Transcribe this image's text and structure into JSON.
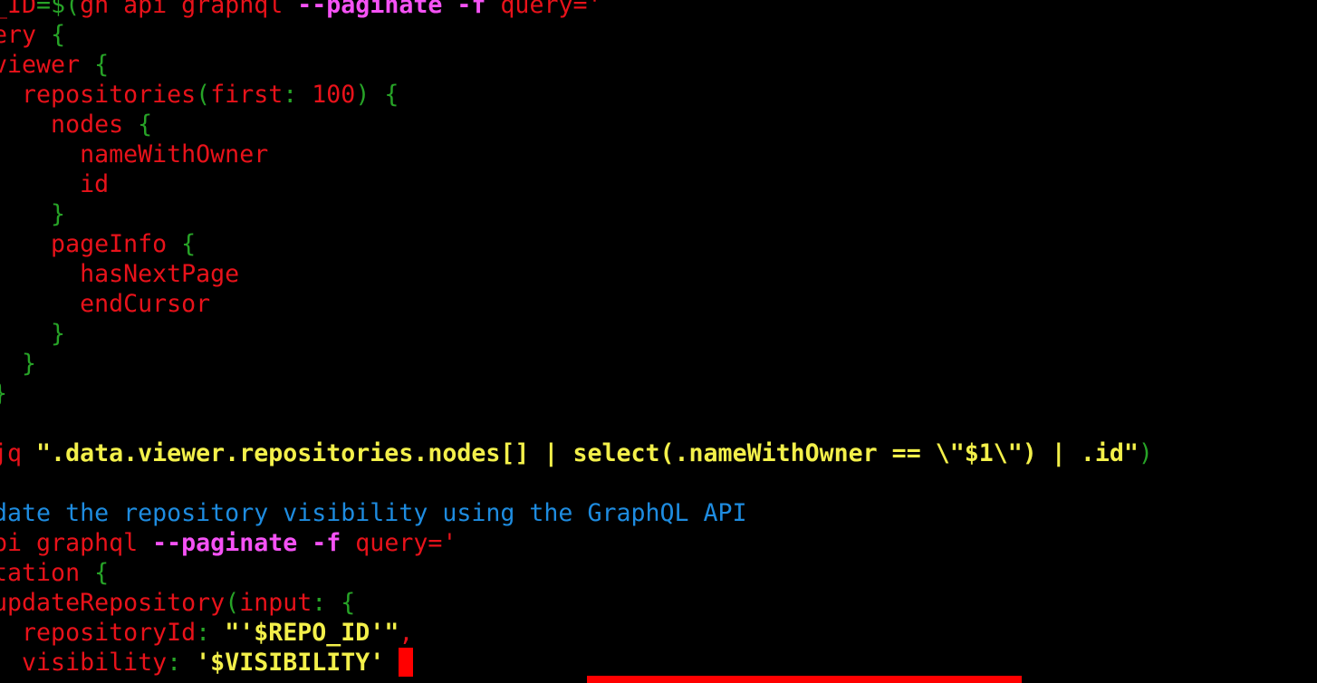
{
  "terminal": {
    "colors": {
      "background": "#000000",
      "red": "#e8121a",
      "green": "#27a327",
      "yellow": "#f3f04a",
      "magenta": "#f552f5",
      "blue": "#1e8ce0",
      "cursor": "#ff0000"
    },
    "lines": [
      {
        "tokens": [
          {
            "t": "D_ID",
            "c": "r"
          },
          {
            "t": "=",
            "c": "g"
          },
          {
            "t": "$(",
            "c": "g"
          },
          {
            "t": "gh api graphql ",
            "c": "r"
          },
          {
            "t": "--paginate -f",
            "c": "m"
          },
          {
            "t": " query",
            "c": "r"
          },
          {
            "t": "='",
            "c": "r"
          }
        ]
      },
      {
        "tokens": [
          {
            "t": "uery ",
            "c": "r"
          },
          {
            "t": "{",
            "c": "g"
          }
        ]
      },
      {
        "tokens": [
          {
            "t": " viewer ",
            "c": "r"
          },
          {
            "t": "{",
            "c": "g"
          }
        ]
      },
      {
        "tokens": [
          {
            "t": "   repositories",
            "c": "r"
          },
          {
            "t": "(",
            "c": "g"
          },
          {
            "t": "first",
            "c": "r"
          },
          {
            "t": ": ",
            "c": "g"
          },
          {
            "t": "100",
            "c": "r"
          },
          {
            "t": ") {",
            "c": "g"
          }
        ]
      },
      {
        "tokens": [
          {
            "t": "     nodes ",
            "c": "r"
          },
          {
            "t": "{",
            "c": "g"
          }
        ]
      },
      {
        "tokens": [
          {
            "t": "       nameWithOwner",
            "c": "r"
          }
        ]
      },
      {
        "tokens": [
          {
            "t": "       id",
            "c": "r"
          }
        ]
      },
      {
        "tokens": [
          {
            "t": "     }",
            "c": "g"
          }
        ]
      },
      {
        "tokens": [
          {
            "t": "     pageInfo ",
            "c": "r"
          },
          {
            "t": "{",
            "c": "g"
          }
        ]
      },
      {
        "tokens": [
          {
            "t": "       hasNextPage",
            "c": "r"
          }
        ]
      },
      {
        "tokens": [
          {
            "t": "       endCursor",
            "c": "r"
          }
        ]
      },
      {
        "tokens": [
          {
            "t": "     }",
            "c": "g"
          }
        ]
      },
      {
        "tokens": [
          {
            "t": "   }",
            "c": "g"
          }
        ]
      },
      {
        "tokens": [
          {
            "t": " }",
            "c": "g"
          }
        ]
      },
      {
        "tokens": []
      },
      {
        "tokens": [
          {
            "t": " jq ",
            "c": "r"
          },
          {
            "t": "\".data.viewer.repositories.nodes[] | select(.nameWithOwner == \\\"$1\\\") | .id\"",
            "c": "y"
          },
          {
            "t": ")",
            "c": "g"
          }
        ]
      },
      {
        "tokens": []
      },
      {
        "tokens": [
          {
            "t": "pdate the repository visibility using the GraphQL API",
            "c": "b"
          }
        ]
      },
      {
        "tokens": [
          {
            "t": "api graphql ",
            "c": "r"
          },
          {
            "t": "--paginate -f",
            "c": "m"
          },
          {
            "t": " query",
            "c": "r"
          },
          {
            "t": "='",
            "c": "r"
          }
        ]
      },
      {
        "tokens": [
          {
            "t": "utation ",
            "c": "r"
          },
          {
            "t": "{",
            "c": "g"
          }
        ]
      },
      {
        "tokens": [
          {
            "t": " updateRepository",
            "c": "r"
          },
          {
            "t": "(",
            "c": "g"
          },
          {
            "t": "input",
            "c": "r"
          },
          {
            "t": ": {",
            "c": "g"
          }
        ]
      },
      {
        "tokens": [
          {
            "t": "   repositoryId",
            "c": "r"
          },
          {
            "t": ": ",
            "c": "g"
          },
          {
            "t": "\"'$REPO_ID'\"",
            "c": "y"
          },
          {
            "t": ",",
            "c": "r"
          }
        ]
      },
      {
        "tokens": [
          {
            "t": "   visibility",
            "c": "r"
          },
          {
            "t": ": ",
            "c": "g"
          },
          {
            "t": "'$VISIBILITY'",
            "c": "y"
          }
        ]
      }
    ]
  }
}
